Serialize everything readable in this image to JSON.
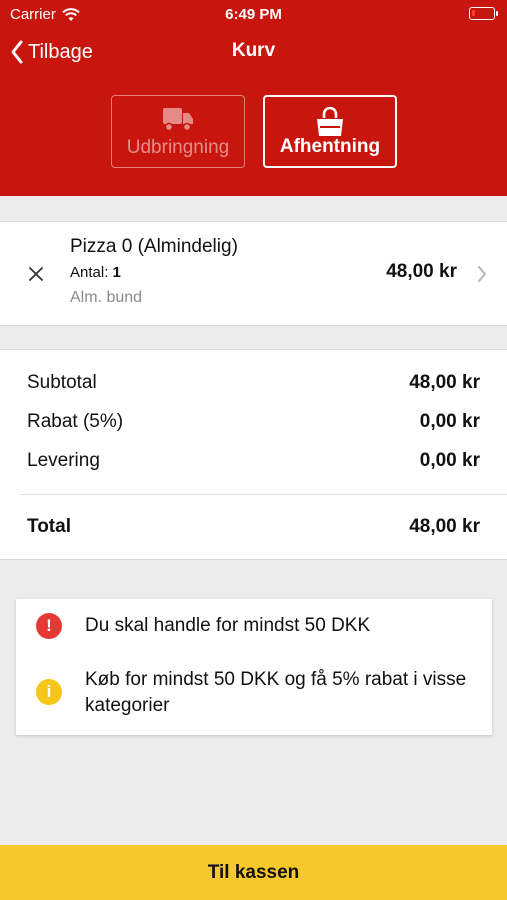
{
  "colors": {
    "header_red": "#c8160e",
    "checkout_yellow": "#f7c82b",
    "error_red": "#e53935",
    "info_yellow": "#f5c518"
  },
  "status_bar": {
    "carrier": "Carrier",
    "time": "6:49 PM",
    "battery_level": 0.15,
    "icons": [
      "wifi-icon",
      "battery-icon"
    ]
  },
  "nav": {
    "back_label": "Tilbage",
    "title": "Kurv"
  },
  "modes": [
    {
      "label": "Udbringning",
      "icon": "truck-icon",
      "selected": false
    },
    {
      "label": "Afhentning",
      "icon": "shopping-bag-icon",
      "selected": true
    }
  ],
  "cart_items": [
    {
      "name": "Pizza 0 (Almindelig)",
      "qty_label": "Antal:",
      "qty": "1",
      "option": "Alm. bund",
      "price": "48,00 kr"
    }
  ],
  "totals": {
    "subtotal_label": "Subtotal",
    "subtotal": "48,00 kr",
    "discount_label": "Rabat (5%)",
    "discount": "0,00 kr",
    "delivery_label": "Levering",
    "delivery": "0,00 kr",
    "total_label": "Total",
    "total": "48,00 kr"
  },
  "notices": [
    {
      "type": "error",
      "icon_text": "!",
      "text": "Du skal handle for mindst 50 DKK"
    },
    {
      "type": "info",
      "icon_text": "i",
      "text": "Køb for mindst 50 DKK og få 5% rabat i visse kategorier"
    }
  ],
  "checkout_label": "Til kassen"
}
